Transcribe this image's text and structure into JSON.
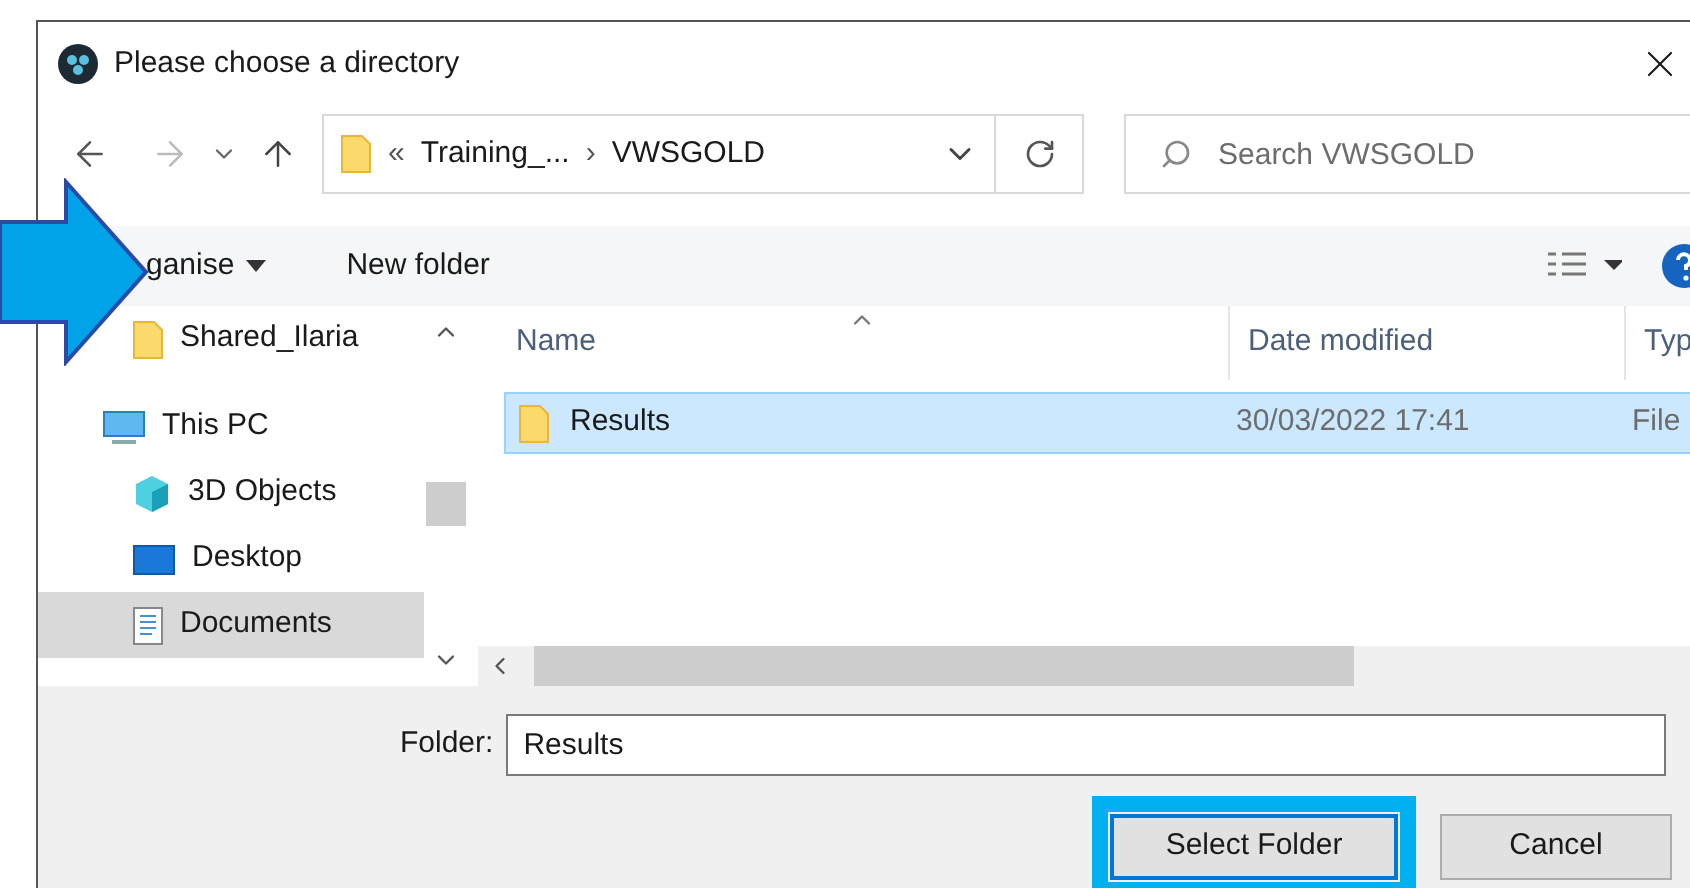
{
  "window": {
    "title": "Please choose a directory"
  },
  "address": {
    "overflow": "«",
    "parent": "Training_...",
    "separator": "›",
    "current": "VWSGOLD"
  },
  "search": {
    "placeholder": "Search VWSGOLD"
  },
  "toolbar": {
    "organise": "ganise",
    "new_folder": "New folder"
  },
  "sidebar": {
    "items": [
      {
        "label": "Shared_Ilaria",
        "kind": "folder",
        "selected": false
      },
      {
        "label": "This PC",
        "kind": "pc",
        "selected": false,
        "children": [
          {
            "label": "3D Objects",
            "kind": "cube",
            "selected": false
          },
          {
            "label": "Desktop",
            "kind": "desktop",
            "selected": false
          },
          {
            "label": "Documents",
            "kind": "documents",
            "selected": true
          }
        ]
      }
    ]
  },
  "table": {
    "columns": [
      "Name",
      "Date modified",
      "Typ"
    ],
    "rows": [
      {
        "name": "Results",
        "date": "30/03/2022 17:41",
        "type": "File",
        "selected": true
      }
    ]
  },
  "folder_field": {
    "label": "Folder:",
    "value": "Results"
  },
  "buttons": [
    {
      "label": "Select Folder",
      "highlighted": true
    },
    {
      "label": "Cancel",
      "highlighted": false
    }
  ]
}
